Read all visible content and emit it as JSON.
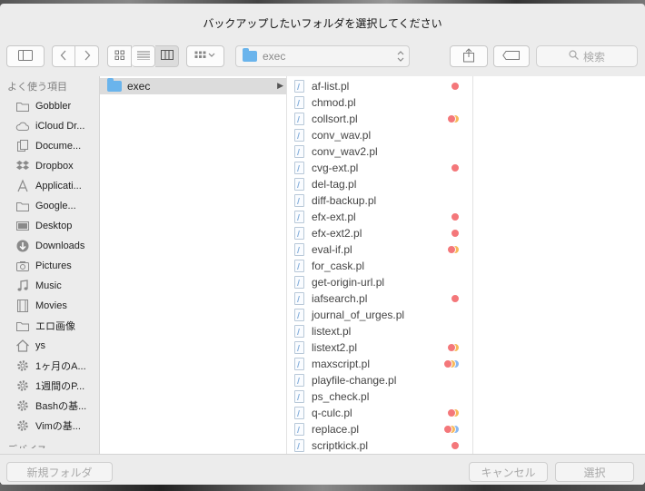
{
  "dialog": {
    "title": "バックアップしたいフォルダを選択してください"
  },
  "toolbar": {
    "path_folder": "exec",
    "search_placeholder": "検索"
  },
  "sidebar": {
    "section_favorites": "よく使う項目",
    "section_devices": "デバイス",
    "items": [
      {
        "label": "Gobbler",
        "icon": "folder-icon"
      },
      {
        "label": "iCloud Dr...",
        "icon": "cloud-icon"
      },
      {
        "label": "Docume...",
        "icon": "document-icon"
      },
      {
        "label": "Dropbox",
        "icon": "dropbox-icon"
      },
      {
        "label": "Applicati...",
        "icon": "applications-icon"
      },
      {
        "label": "Google...",
        "icon": "folder-icon"
      },
      {
        "label": "Desktop",
        "icon": "desktop-icon"
      },
      {
        "label": "Downloads",
        "icon": "download-icon"
      },
      {
        "label": "Pictures",
        "icon": "camera-icon"
      },
      {
        "label": "Music",
        "icon": "music-icon"
      },
      {
        "label": "Movies",
        "icon": "film-icon"
      },
      {
        "label": "エロ画像",
        "icon": "folder-icon"
      },
      {
        "label": "ys",
        "icon": "home-icon"
      },
      {
        "label": "1ヶ月のA...",
        "icon": "gear-icon"
      },
      {
        "label": "1週間のP...",
        "icon": "gear-icon"
      },
      {
        "label": "Bashの基...",
        "icon": "gear-icon"
      },
      {
        "label": "Vimの基...",
        "icon": "gear-icon"
      }
    ]
  },
  "column1": {
    "folder": "exec"
  },
  "files": [
    {
      "name": "af-list.pl",
      "tags": [
        "#f4777a"
      ]
    },
    {
      "name": "chmod.pl",
      "tags": []
    },
    {
      "name": "collsort.pl",
      "tags": [
        "#f4777a",
        "#f7b85a"
      ]
    },
    {
      "name": "conv_wav.pl",
      "tags": []
    },
    {
      "name": "conv_wav2.pl",
      "tags": []
    },
    {
      "name": "cvg-ext.pl",
      "tags": [
        "#f4777a"
      ]
    },
    {
      "name": "del-tag.pl",
      "tags": []
    },
    {
      "name": "diff-backup.pl",
      "tags": []
    },
    {
      "name": "efx-ext.pl",
      "tags": [
        "#f4777a"
      ]
    },
    {
      "name": "efx-ext2.pl",
      "tags": [
        "#f4777a"
      ]
    },
    {
      "name": "eval-if.pl",
      "tags": [
        "#f4777a",
        "#f7b85a"
      ]
    },
    {
      "name": "for_cask.pl",
      "tags": []
    },
    {
      "name": "get-origin-url.pl",
      "tags": []
    },
    {
      "name": "iafsearch.pl",
      "tags": [
        "#f4777a"
      ]
    },
    {
      "name": "journal_of_urges.pl",
      "tags": []
    },
    {
      "name": "listext.pl",
      "tags": []
    },
    {
      "name": "listext2.pl",
      "tags": [
        "#f4777a",
        "#f7b85a"
      ]
    },
    {
      "name": "maxscript.pl",
      "tags": [
        "#f4777a",
        "#f7b85a",
        "#8ab8f0"
      ]
    },
    {
      "name": "playfile-change.pl",
      "tags": []
    },
    {
      "name": "ps_check.pl",
      "tags": []
    },
    {
      "name": "q-culc.pl",
      "tags": [
        "#f4777a",
        "#f7b85a"
      ]
    },
    {
      "name": "replace.pl",
      "tags": [
        "#f4777a",
        "#f7b85a",
        "#8ab8f0"
      ]
    },
    {
      "name": "scriptkick.pl",
      "tags": [
        "#f4777a"
      ]
    }
  ],
  "footer": {
    "new_folder": "新規フォルダ",
    "cancel": "キャンセル",
    "choose": "選択"
  }
}
